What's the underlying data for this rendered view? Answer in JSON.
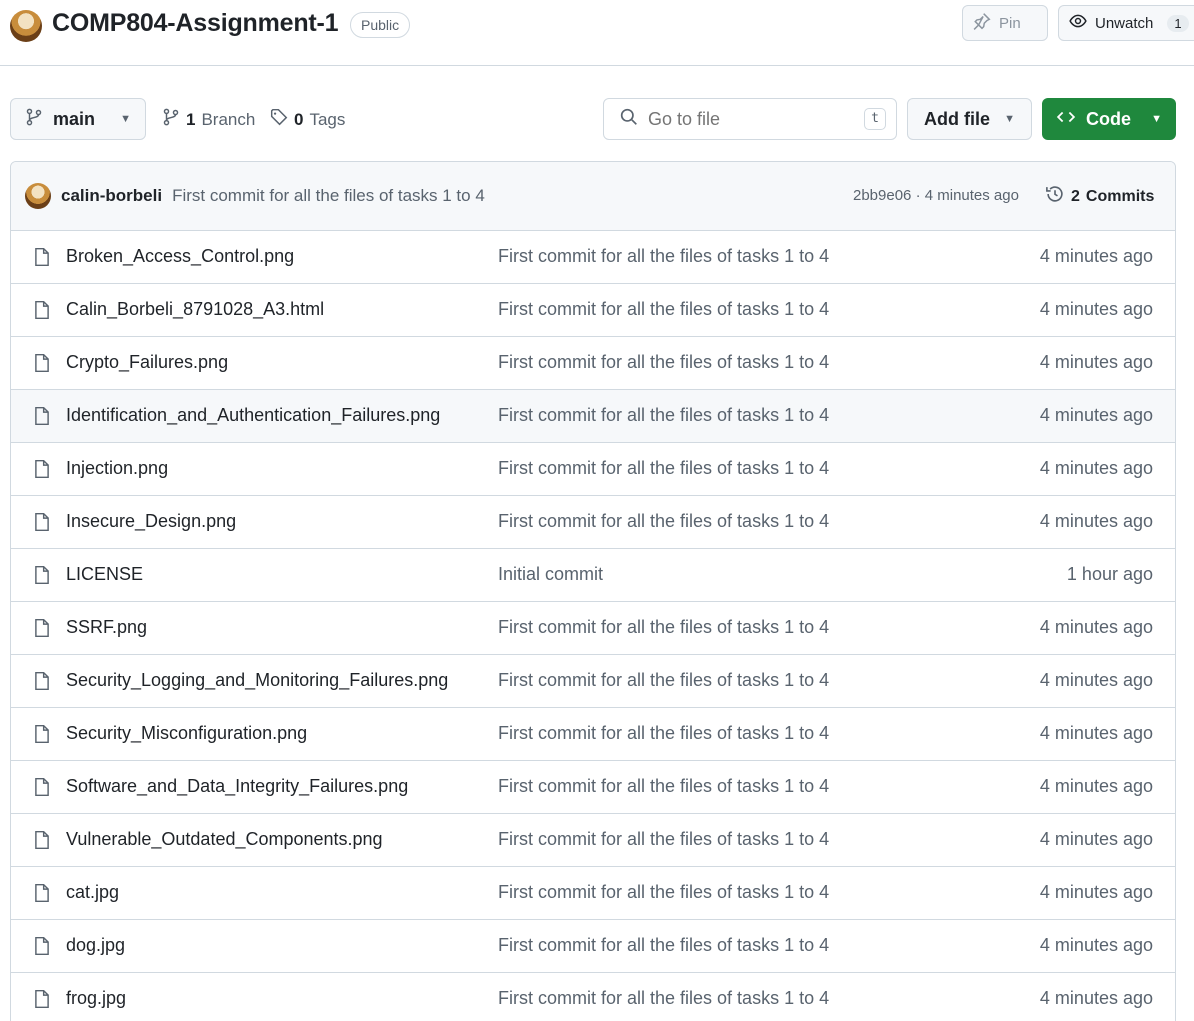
{
  "repo": {
    "title": "COMP804-Assignment-1",
    "visibility": "Public"
  },
  "header_actions": {
    "pin_label": "Pin",
    "unwatch_label": "Unwatch",
    "watch_count": "1"
  },
  "toolbar": {
    "branch": "main",
    "branches_count": "1",
    "branches_label": "Branch",
    "tags_count": "0",
    "tags_label": "Tags",
    "search_placeholder": "Go to file",
    "search_shortcut": "t",
    "add_file_label": "Add file",
    "code_label": "Code"
  },
  "latest_commit": {
    "author": "calin-borbeli",
    "message": "First commit for all the files of tasks 1 to 4",
    "meta": "2bb9e06 · 4 minutes ago",
    "commits_count": "2",
    "commits_label": "Commits"
  },
  "files": [
    {
      "name": "Broken_Access_Control.png",
      "commit": "First commit for all the files of tasks 1 to 4",
      "time": "4 minutes ago"
    },
    {
      "name": "Calin_Borbeli_8791028_A3.html",
      "commit": "First commit for all the files of tasks 1 to 4",
      "time": "4 minutes ago"
    },
    {
      "name": "Crypto_Failures.png",
      "commit": "First commit for all the files of tasks 1 to 4",
      "time": "4 minutes ago"
    },
    {
      "name": "Identification_and_Authentication_Failures.png",
      "commit": "First commit for all the files of tasks 1 to 4",
      "time": "4 minutes ago"
    },
    {
      "name": "Injection.png",
      "commit": "First commit for all the files of tasks 1 to 4",
      "time": "4 minutes ago"
    },
    {
      "name": "Insecure_Design.png",
      "commit": "First commit for all the files of tasks 1 to 4",
      "time": "4 minutes ago"
    },
    {
      "name": "LICENSE",
      "commit": "Initial commit",
      "time": "1 hour ago"
    },
    {
      "name": "SSRF.png",
      "commit": "First commit for all the files of tasks 1 to 4",
      "time": "4 minutes ago"
    },
    {
      "name": "Security_Logging_and_Monitoring_Failures.png",
      "commit": "First commit for all the files of tasks 1 to 4",
      "time": "4 minutes ago"
    },
    {
      "name": "Security_Misconfiguration.png",
      "commit": "First commit for all the files of tasks 1 to 4",
      "time": "4 minutes ago"
    },
    {
      "name": "Software_and_Data_Integrity_Failures.png",
      "commit": "First commit for all the files of tasks 1 to 4",
      "time": "4 minutes ago"
    },
    {
      "name": "Vulnerable_Outdated_Components.png",
      "commit": "First commit for all the files of tasks 1 to 4",
      "time": "4 minutes ago"
    },
    {
      "name": "cat.jpg",
      "commit": "First commit for all the files of tasks 1 to 4",
      "time": "4 minutes ago"
    },
    {
      "name": "dog.jpg",
      "commit": "First commit for all the files of tasks 1 to 4",
      "time": "4 minutes ago"
    },
    {
      "name": "frog.jpg",
      "commit": "First commit for all the files of tasks 1 to 4",
      "time": "4 minutes ago"
    }
  ],
  "icons": {
    "pin": "pin-icon",
    "eye": "eye-icon",
    "branch": "git-branch-icon",
    "tag": "tag-icon",
    "search": "search-icon",
    "code": "code-icon",
    "history": "history-icon",
    "file": "file-icon"
  },
  "colors": {
    "code_button": "#1f883d",
    "muted_text": "#59636e",
    "border": "#d1d9e0"
  }
}
